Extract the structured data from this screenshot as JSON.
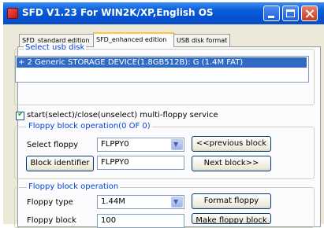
{
  "window": {
    "title": "SFD V1.23 For WIN2K/XP,English OS"
  },
  "tabs": [
    {
      "label": "SFD_standard edition"
    },
    {
      "label": "SFD_enhanced edition"
    },
    {
      "label": "USB disk format"
    }
  ],
  "usb": {
    "legend": "Select usb disk",
    "device_item": "+ 2 Generic STORAGE DEVICE(1.8GB512B): G (1.4M FAT)"
  },
  "multi_floppy": {
    "checked": true,
    "label": "start(select)/close(unselect) multi-floppy service"
  },
  "block_operation": {
    "legend": "Floppy block operation(0 OF 0)",
    "select_floppy_label": "Select floppy",
    "select_floppy_value": "FLPPY0",
    "prev_block_label": "<<previous block",
    "block_identifier_label": "Block identifier",
    "block_identifier_value": "FLPPY0",
    "next_block_label": "Next block>>"
  },
  "floppy_operation": {
    "legend": "Floppy block operation",
    "floppy_type_label": "Floppy type",
    "floppy_type_value": "1.44M",
    "format_label": "Format floppy",
    "floppy_block_label": "Floppy block",
    "floppy_block_value": "100",
    "make_block_label": "Make floppy block"
  },
  "icons": {
    "app": "app-icon",
    "minimize": "minimize-icon",
    "maximize": "maximize-icon",
    "close": "close-icon",
    "dropdown": "chevron-down-icon",
    "checkmark": "checkmark-icon"
  },
  "colors": {
    "titlebar": "#0a5fd8",
    "selection": "#316ac5",
    "group_legend": "#0046d5",
    "window_bg": "#ece9d8"
  }
}
